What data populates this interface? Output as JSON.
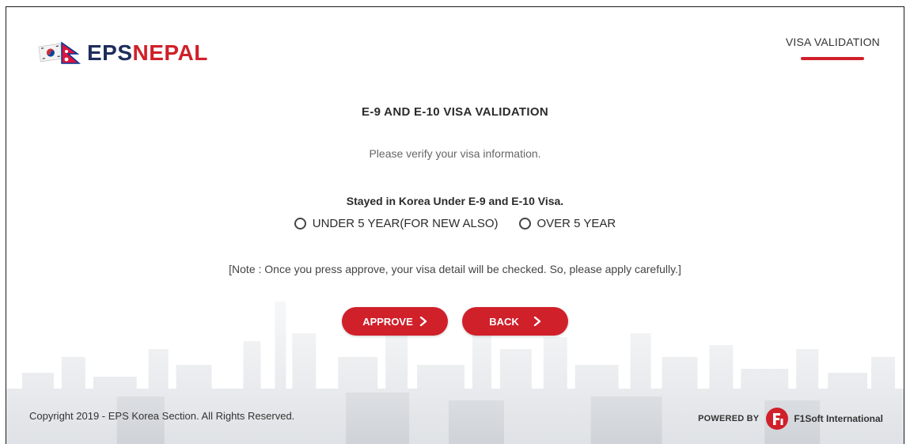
{
  "header": {
    "logo": {
      "text_dark": "EPS",
      "text_red": "NEPAL"
    },
    "nav_tab": "VISA VALIDATION"
  },
  "form": {
    "title": "E-9 AND E-10 VISA VALIDATION",
    "subtitle": "Please verify your visa information.",
    "question": "Stayed in Korea Under E-9 and E-10 Visa.",
    "options": [
      {
        "label": "UNDER 5 YEAR(FOR NEW ALSO)",
        "selected": false
      },
      {
        "label": "OVER 5 YEAR",
        "selected": false
      }
    ],
    "note": "[Note : Once you press approve, your visa detail will be checked. So, please apply carefully.]",
    "approve_label": "APPROVE",
    "back_label": "BACK"
  },
  "footer": {
    "copyright": "Copyright 2019 - EPS Korea Section. All Rights Reserved.",
    "powered_by": "POWERED BY",
    "company": "F1Soft International"
  },
  "colors": {
    "brand_red": "#d0202a",
    "brand_navy": "#1f2d5c"
  },
  "icons": [
    "korea-nepal-flags-icon",
    "chevron-right-icon",
    "f1soft-logo-icon",
    "radio-unchecked-icon"
  ]
}
